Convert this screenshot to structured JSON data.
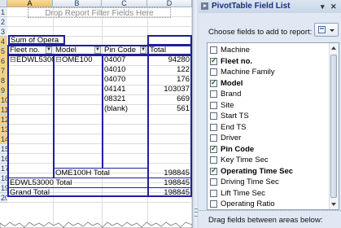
{
  "sheet": {
    "columns": [
      "A",
      "B",
      "C",
      "D"
    ],
    "rows": [
      "1",
      "2",
      "3",
      "4",
      "5",
      "6",
      "7",
      "8",
      "9",
      "10",
      "11",
      "12",
      "13",
      "14",
      "15",
      "16",
      "17",
      "18",
      "19",
      "20"
    ],
    "drop_filter_text": "Drop Report Filter Fields Here",
    "pivot": {
      "sum_header": "Sum of Opera",
      "headers": {
        "fleet": "Fleet no.",
        "model": "Model",
        "pin": "Pin Code",
        "total": "Total"
      },
      "fleet_value": "EDWL5300",
      "model_value": "OME100",
      "pin_rows": [
        {
          "pin": "04007",
          "total": "94280"
        },
        {
          "pin": "04010",
          "total": "122"
        },
        {
          "pin": "04070",
          "total": "176"
        },
        {
          "pin": "04141",
          "total": "103037"
        },
        {
          "pin": "08321",
          "total": "669"
        },
        {
          "pin": "(blank)",
          "total": "561"
        }
      ],
      "model_total_label": "OME100H Total",
      "model_total_value": "198845",
      "fleet_total_label": "EDWL53000 Total",
      "fleet_total_value": "198845",
      "grand_total_label": "Grand Total",
      "grand_total_value": "198845",
      "expand_glyph": "⊟"
    }
  },
  "pane": {
    "title": "PivotTable Field List",
    "dropdown_glyph": "▾",
    "close_glyph": "✕",
    "choose_label": "Choose fields to add to report:",
    "fields": [
      {
        "label": "Machine",
        "checked": false
      },
      {
        "label": "Fleet no.",
        "checked": true
      },
      {
        "label": "Machine Family",
        "checked": false
      },
      {
        "label": "Model",
        "checked": true
      },
      {
        "label": "Brand",
        "checked": false
      },
      {
        "label": "Site",
        "checked": false
      },
      {
        "label": "Start TS",
        "checked": false
      },
      {
        "label": "End TS",
        "checked": false
      },
      {
        "label": "Driver",
        "checked": false
      },
      {
        "label": "Pin Code",
        "checked": true
      },
      {
        "label": "Key Time Sec",
        "checked": false
      },
      {
        "label": "Operating Time Sec",
        "checked": true
      },
      {
        "label": "Driving Time Sec",
        "checked": false
      },
      {
        "label": "Lift Time Sec",
        "checked": false
      },
      {
        "label": "Operating Ratio",
        "checked": false
      }
    ],
    "drag_label": "Drag fields between areas below:"
  }
}
